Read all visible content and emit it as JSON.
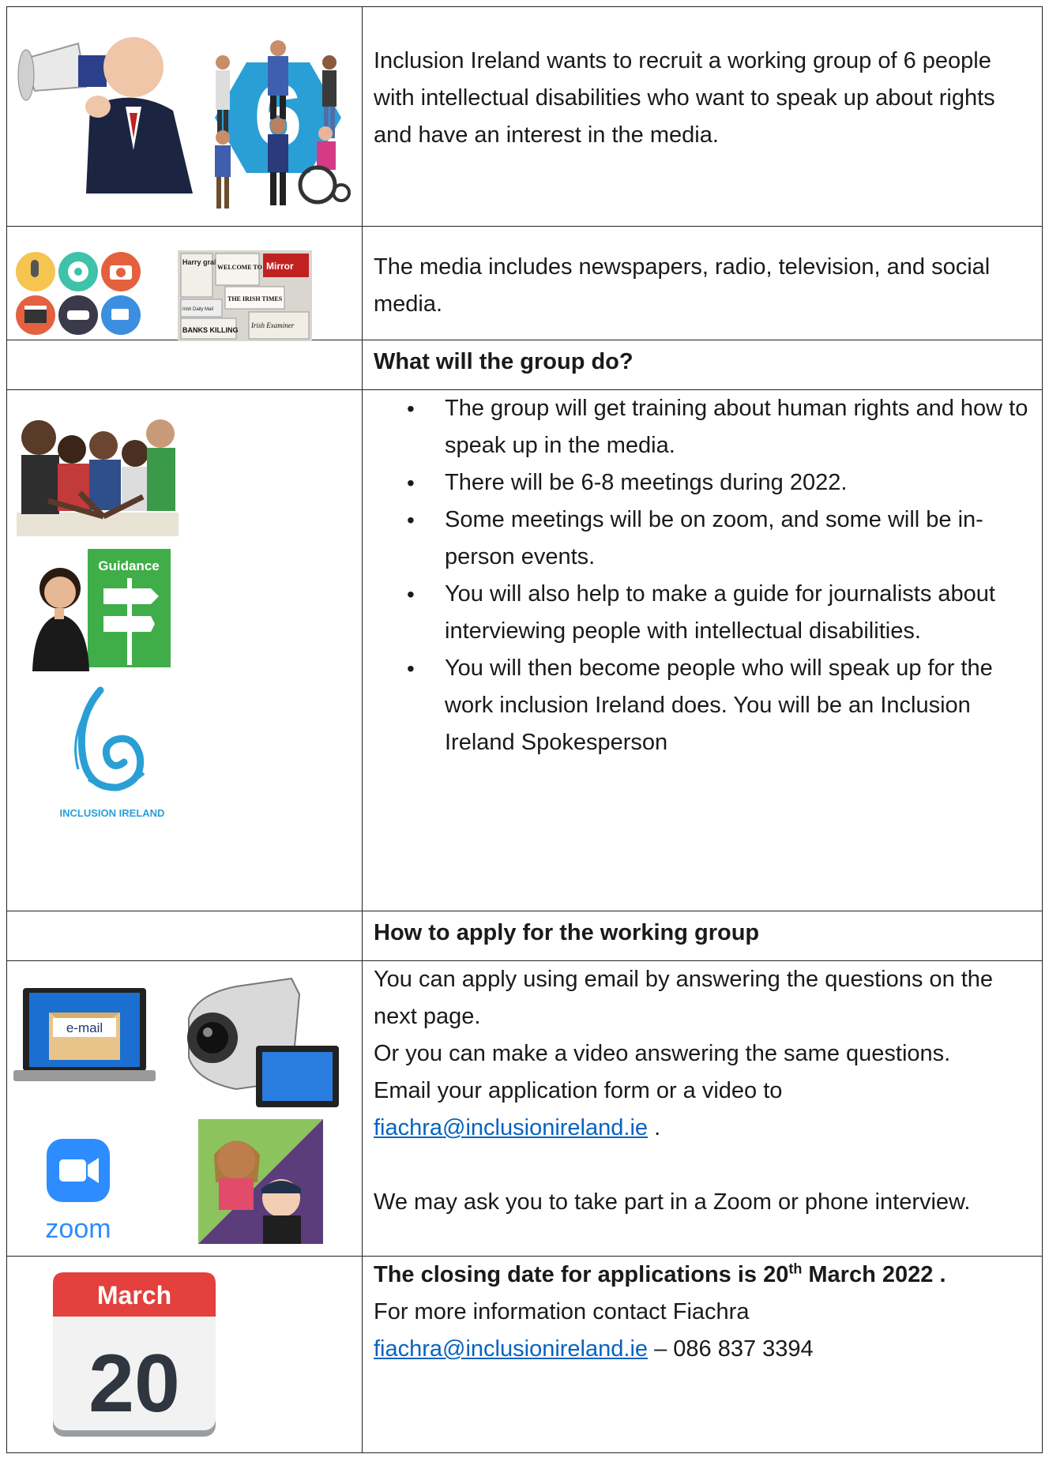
{
  "intro": {
    "text": "Inclusion Ireland wants to recruit a working group of 6 people with intellectual disabilities who want to speak up about rights and have an interest in the media.",
    "six_label": "6"
  },
  "media": {
    "text": "The media includes newspapers, radio, television, and social media.",
    "newspaper_words": [
      "Harry grabs the crown",
      "WELCOME TO DUBLIN",
      "Mirror",
      "THE IRISH TIMES",
      "Irish Daily Mail",
      "BANKS KILLING",
      "Irish Examiner"
    ]
  },
  "group": {
    "heading": "What will the group do?",
    "bullets": [
      "The group will get training about human rights and how to speak up in the media.",
      "There will be 6-8 meetings during 2022.",
      "Some meetings will be on zoom, and some will be in-person events.",
      "You will also help to make a guide for journalists about interviewing people with intellectual disabilities.",
      "You will then become people who will speak up for the work inclusion Ireland does. You will be an Inclusion Ireland Spokesperson"
    ],
    "guidance_label": "Guidance",
    "logo_text": "INCLUSION IRELAND"
  },
  "apply": {
    "heading": "How to apply for the working group",
    "line1": "You can apply using email by answering the questions on the next page.",
    "line2": "Or you can make a video answering the same questions.",
    "line3": "Email your application form or a video to",
    "email": "fiachra@inclusionireland.ie",
    "email_suffix": " .",
    "line4": "We may ask you to take part in a Zoom or phone interview.",
    "email_icon_label": "e-mail",
    "zoom_label": "zoom"
  },
  "closing": {
    "text_prefix": "The closing date for applications is 20",
    "text_sup": "th",
    "text_suffix": " March 2022 .",
    "info": "For more information contact Fiachra",
    "email": "fiachra@inclusionireland.ie",
    "phone": " – 086 837 3394",
    "calendar_month": "March",
    "calendar_day": "20"
  },
  "colors": {
    "link": "#0563c1",
    "inclusion_blue": "#2a9fd6",
    "calendar_red": "#e4403d",
    "zoom_blue": "#2d8cff",
    "guidance_green": "#3fae49"
  }
}
